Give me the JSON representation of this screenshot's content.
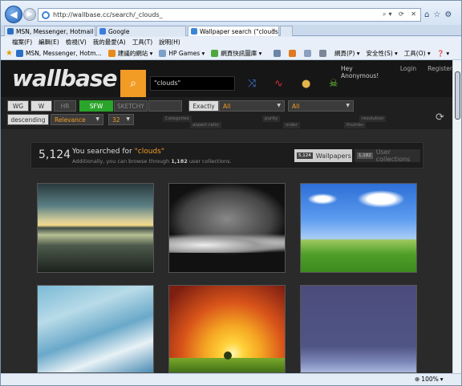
{
  "browser": {
    "url": "http://wallbase.cc/search/_clouds_",
    "tabs": [
      {
        "label": "MSN, Messenger, Hotmail - ...",
        "color": "#2b6fc4"
      },
      {
        "label": "Google",
        "color": "#3b7de0"
      },
      {
        "label": "Wallpaper search (\"clouds...",
        "color": "#3a86d8"
      }
    ],
    "menu": [
      "檔案(F)",
      "編輯(E)",
      "檢視(V)",
      "我的最愛(A)",
      "工具(T)",
      "說明(H)"
    ],
    "favorites": [
      {
        "label": "MSN, Messenger, Hotm...",
        "color": "#2b6fc4"
      },
      {
        "label": "建議的網站 ▾",
        "color": "#e78b1a"
      },
      {
        "label": "HP Games ▾",
        "color": "#7fa0c7"
      },
      {
        "label": "網頁快訊圖庫 ▾",
        "color": "#4fa83d"
      }
    ],
    "command_bar": [
      "網頁(P) ▾",
      "安全性(S) ▾",
      "工具(O) ▾",
      "❓ ▾"
    ],
    "zoom": "100%"
  },
  "site": {
    "logo": "wallbase",
    "search_value": "\"clouds\"",
    "user_greeting": "Hey Anonymous!",
    "login": "Login",
    "register": "Register"
  },
  "filters": {
    "boards": [
      "WG",
      "W",
      "HR"
    ],
    "purity": [
      "SFW",
      "SKETCHY"
    ],
    "match_label": "Exactly",
    "resolution_value": "All",
    "aspect_value": "All",
    "order_value": "descending",
    "sort_value": "Relevance",
    "thumbs_value": "32",
    "captions": {
      "categories": "Categories",
      "aspect_ratio": "aspect ratio",
      "purity": "purity",
      "order": "order",
      "resolution": "resolution",
      "thumbs": "thumbs"
    }
  },
  "results": {
    "count": "5,124",
    "searched_prefix": "You searched for ",
    "query": "\"clouds\"",
    "browse_prefix": "Additionally, you can browse through ",
    "collections_count": "1,182",
    "browse_suffix": " user collections.",
    "wallpapers_badge": "5,124",
    "wallpapers_label": "Wallpapers",
    "collections_badge": "1,182",
    "collections_label": "User collections"
  },
  "thumbnails": [
    "sunset-clouds-over-water",
    "planet-over-clouds",
    "blue-sky-green-field",
    "bright-blue-clouds",
    "sunrise-over-hills",
    "purple-sky-horizon"
  ]
}
